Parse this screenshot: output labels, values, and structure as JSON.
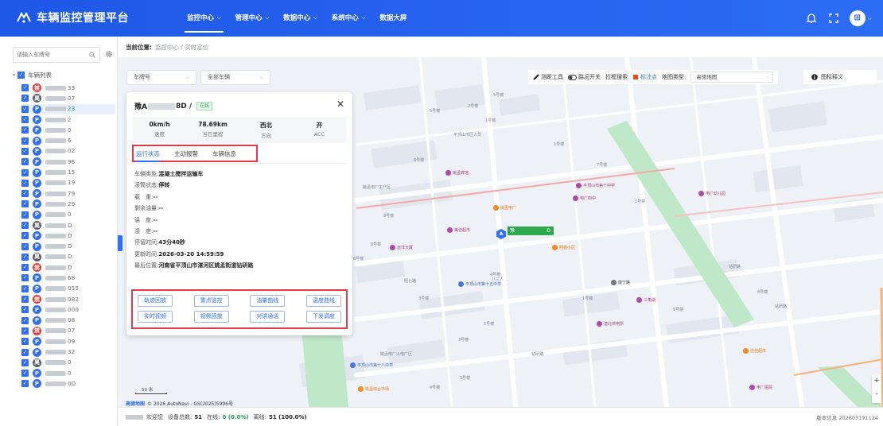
{
  "app": {
    "title": "车辆监控管理平台"
  },
  "nav": [
    {
      "label": "监控中心",
      "has_caret": true,
      "active": true
    },
    {
      "label": "管理中心",
      "has_caret": true
    },
    {
      "label": "数据中心",
      "has_caret": true
    },
    {
      "label": "系统中心",
      "has_caret": true
    },
    {
      "label": "数据大屏",
      "has_caret": false
    }
  ],
  "sidebar": {
    "search_placeholder": "请输入车牌号",
    "root_label": "车辆列表",
    "vehicles": [
      {
        "status": "red",
        "icon": "禁",
        "suffix": "33"
      },
      {
        "status": "gray",
        "icon": "离",
        "suffix": "07"
      },
      {
        "status": "blue",
        "icon": "P",
        "suffix": "23",
        "selected": true
      },
      {
        "status": "blue",
        "icon": "P",
        "suffix": "2"
      },
      {
        "status": "blue",
        "icon": "P",
        "suffix": "0"
      },
      {
        "status": "blue",
        "icon": "P",
        "suffix": "6"
      },
      {
        "status": "blue",
        "icon": "P",
        "suffix": "02"
      },
      {
        "status": "blue",
        "icon": "P",
        "suffix": "96"
      },
      {
        "status": "blue",
        "icon": "P",
        "suffix": "15"
      },
      {
        "status": "blue",
        "icon": "P",
        "suffix": "19"
      },
      {
        "status": "blue",
        "icon": "P",
        "suffix": "79"
      },
      {
        "status": "blue",
        "icon": "P",
        "suffix": "29"
      },
      {
        "status": "blue",
        "icon": "P",
        "suffix": "0"
      },
      {
        "status": "gray",
        "icon": "离",
        "suffix": "D"
      },
      {
        "status": "blue",
        "icon": "P",
        "suffix": "D"
      },
      {
        "status": "blue",
        "icon": "P",
        "suffix": "D"
      },
      {
        "status": "gray",
        "icon": "离",
        "suffix": "D"
      },
      {
        "status": "red",
        "icon": "禁",
        "suffix": "D"
      },
      {
        "status": "blue",
        "icon": "P",
        "suffix": "68"
      },
      {
        "status": "blue",
        "icon": "P",
        "suffix": "055"
      },
      {
        "status": "red",
        "icon": "禁",
        "suffix": "082"
      },
      {
        "status": "blue",
        "icon": "P",
        "suffix": "000"
      },
      {
        "status": "blue",
        "icon": "P",
        "suffix": "08"
      },
      {
        "status": "red",
        "icon": "禁",
        "suffix": "07"
      },
      {
        "status": "blue",
        "icon": "P",
        "suffix": "09"
      },
      {
        "status": "blue",
        "icon": "P",
        "suffix": "32"
      },
      {
        "status": "gray",
        "icon": "离",
        "suffix": "0"
      },
      {
        "status": "blue",
        "icon": "P",
        "suffix": "0"
      },
      {
        "status": "blue",
        "icon": "P",
        "suffix": "0D"
      }
    ]
  },
  "breadcrumb": {
    "label": "当前位置:",
    "path": "监控中心 / 实时定位"
  },
  "map_filters": {
    "plate_select": "车牌号",
    "range_select": "全部车辆"
  },
  "map_tools": {
    "ranging": "测距工具",
    "road": "路况开关",
    "pull_search": "拉框搜索",
    "marker": "标注点",
    "map_type_label": "地图类型:",
    "map_type_value": "高德地图",
    "legend": "图标释义"
  },
  "panel": {
    "plate_prefix": "豫A",
    "plate_suffix": "8D /",
    "status_tag": "在线",
    "stats": [
      {
        "value": "0km/h",
        "label": "速度"
      },
      {
        "value": "78.69km",
        "label": "当日里程"
      },
      {
        "value": "西北",
        "label": "方向"
      },
      {
        "value": "开",
        "label": "ACC"
      }
    ],
    "tabs": [
      "运行状态",
      "主动报警",
      "车辆信息"
    ],
    "info": [
      {
        "k": "车辆类型:",
        "v": "混凝土搅拌运输车"
      },
      {
        "k": "滚筒状态:",
        "v": "停转"
      },
      {
        "k": "载　重:",
        "v": "--"
      },
      {
        "k": "剩余油量:",
        "v": "--"
      },
      {
        "k": "温　度:",
        "v": "--"
      },
      {
        "k": "湿　度:",
        "v": "--"
      },
      {
        "k": "停留时间:",
        "v": "43分40秒"
      },
      {
        "k": "更新时间:",
        "v": "2026-03-20 14:59:59"
      },
      {
        "k": "最后位置:",
        "v": "河南省平顶山市湛河区姚孟街道钻研路"
      }
    ],
    "actions_row1": [
      "轨迹回放",
      "重点监控",
      "油量曲线",
      "温度曲线"
    ],
    "actions_row2": [
      "实时视频",
      "视频回放",
      "对讲通话",
      "下发调度"
    ]
  },
  "map_labels": [
    {
      "t": "5号楼"
    },
    {
      "t": "2号楼"
    },
    {
      "t": "5号楼"
    },
    {
      "t": "平顶山市区人员"
    },
    {
      "t": "6号楼"
    },
    {
      "t": "1号楼"
    },
    {
      "t": "姚孟电厂生产区"
    },
    {
      "t": "1号楼"
    },
    {
      "t": "8号楼"
    },
    {
      "t": "9号楼"
    },
    {
      "t": "7号楼"
    },
    {
      "t": "1号楼"
    },
    {
      "t": "6号楼"
    },
    {
      "t": "4号楼"
    },
    {
      "t": "3号楼"
    },
    {
      "t": "2号楼"
    },
    {
      "t": "5号楼"
    },
    {
      "t": "4号楼"
    },
    {
      "t": "3号楼"
    },
    {
      "t": "1号楼"
    },
    {
      "t": "8号楼"
    },
    {
      "t": "9号楼"
    },
    {
      "t": "钻研路"
    },
    {
      "t": "姚孟电厂火电厂区"
    },
    {
      "t": "钻研路"
    },
    {
      "t": "钻研路"
    },
    {
      "t": "八三人"
    },
    {
      "t": "经七路"
    }
  ],
  "pois": [
    {
      "t": "姚孟电厂",
      "c": "orange"
    },
    {
      "t": "姚孟宾馆",
      "c": "purple"
    },
    {
      "t": "远洋大厦",
      "c": "purple"
    },
    {
      "t": "平顶山市第十中学",
      "c": "purple"
    },
    {
      "t": "电厂四中",
      "c": "purple"
    },
    {
      "t": "美佳超市",
      "c": "purple"
    },
    {
      "t": "湛北供电所",
      "c": "purple"
    },
    {
      "t": "电厂幼儿园",
      "c": "purple"
    },
    {
      "t": "平顶山市第十五中学",
      "c": "blue"
    },
    {
      "t": "平顶山市第十八中学",
      "c": "blue"
    },
    {
      "t": "康宁路",
      "c": "gray"
    },
    {
      "t": "姚孟综合市场",
      "c": "orange"
    },
    {
      "t": "三角湖",
      "c": "purple"
    },
    {
      "t": "明盛小区",
      "c": "orange"
    },
    {
      "t": "佳佳超市",
      "c": "orange"
    },
    {
      "t": "电厂医院",
      "c": "purple"
    }
  ],
  "credit": {
    "brand": "高德地图",
    "text": "© 2026 AutoNavi - GS(2025)5996号"
  },
  "scale": "50 米",
  "footer": {
    "welcome": "欢迎您",
    "total_label": "设备总数:",
    "total": "51",
    "online_label": "在线:",
    "online": "0 (0.0%)",
    "offline_label": "离线:",
    "offline": "51 (100.0%)",
    "version": "版本信息 202603191124"
  },
  "colors": {
    "primary": "#2f6ef5",
    "highlight": "#e0394a",
    "online": "#2bb24c"
  }
}
